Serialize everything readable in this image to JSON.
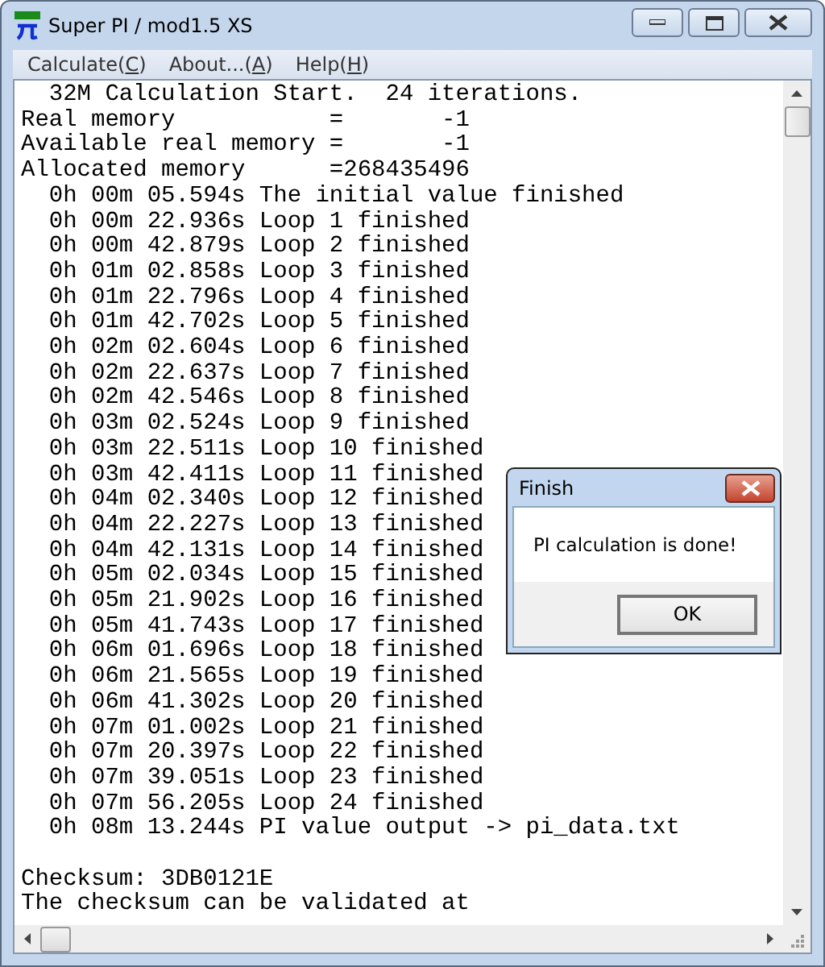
{
  "window": {
    "title": "Super PI / mod1.5 XS"
  },
  "menu": [
    {
      "before": "Calculate(",
      "accelerator": "C",
      "after": ")"
    },
    {
      "before": "About...(",
      "accelerator": "A",
      "after": ")"
    },
    {
      "before": "Help(",
      "accelerator": "H",
      "after": ")"
    }
  ],
  "log": [
    "  32M Calculation Start.  24 iterations.",
    "Real memory           =       -1",
    "Available real memory =       -1",
    "Allocated memory      =268435496",
    "  0h 00m 05.594s The initial value finished",
    "  0h 00m 22.936s Loop 1 finished",
    "  0h 00m 42.879s Loop 2 finished",
    "  0h 01m 02.858s Loop 3 finished",
    "  0h 01m 22.796s Loop 4 finished",
    "  0h 01m 42.702s Loop 5 finished",
    "  0h 02m 02.604s Loop 6 finished",
    "  0h 02m 22.637s Loop 7 finished",
    "  0h 02m 42.546s Loop 8 finished",
    "  0h 03m 02.524s Loop 9 finished",
    "  0h 03m 22.511s Loop 10 finished",
    "  0h 03m 42.411s Loop 11 finished",
    "  0h 04m 02.340s Loop 12 finished",
    "  0h 04m 22.227s Loop 13 finished",
    "  0h 04m 42.131s Loop 14 finished",
    "  0h 05m 02.034s Loop 15 finished",
    "  0h 05m 21.902s Loop 16 finished",
    "  0h 05m 41.743s Loop 17 finished",
    "  0h 06m 01.696s Loop 18 finished",
    "  0h 06m 21.565s Loop 19 finished",
    "  0h 06m 41.302s Loop 20 finished",
    "  0h 07m 01.002s Loop 21 finished",
    "  0h 07m 20.397s Loop 22 finished",
    "  0h 07m 39.051s Loop 23 finished",
    "  0h 07m 56.205s Loop 24 finished",
    "  0h 08m 13.244s PI value output -> pi_data.txt"
  ],
  "checksum_lines": [
    "Checksum: 3DB0121E",
    "The checksum can be validated at"
  ],
  "dialog": {
    "title": "Finish",
    "message": "PI calculation is done!",
    "button": "OK"
  }
}
